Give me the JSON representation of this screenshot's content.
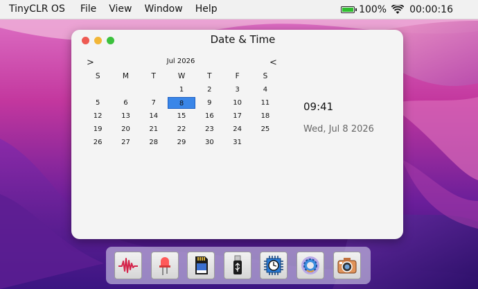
{
  "menubar": {
    "app_name": "TinyCLR OS",
    "menus": [
      "File",
      "View",
      "Window",
      "Help"
    ],
    "battery_percent": "100%",
    "battery_level": 1.0,
    "clock": "00:00:16"
  },
  "window": {
    "title": "Date & Time",
    "calendar": {
      "month_label": "Jul 2026",
      "next_glyph": ">",
      "prev_glyph": "<",
      "weekdays": [
        "S",
        "M",
        "T",
        "W",
        "T",
        "F",
        "S"
      ],
      "weeks": [
        [
          "",
          "",
          "",
          "1",
          "2",
          "3",
          "4"
        ],
        [
          "5",
          "6",
          "7",
          "8",
          "9",
          "10",
          "11"
        ],
        [
          "12",
          "13",
          "14",
          "15",
          "16",
          "17",
          "18"
        ],
        [
          "19",
          "20",
          "21",
          "22",
          "23",
          "24",
          "25"
        ],
        [
          "26",
          "27",
          "28",
          "29",
          "30",
          "31",
          ""
        ]
      ],
      "selected_day": "8"
    },
    "time": "09:41",
    "date": "Wed, Jul 8 2026"
  },
  "dock": {
    "icons": [
      "waveform-icon",
      "led-icon",
      "sd-card-icon",
      "usb-drive-icon",
      "chip-clock-icon",
      "settings-gear-icon",
      "camera-icon"
    ]
  },
  "colors": {
    "selected_day": "#3a86e8",
    "battery": "#2fbf2f"
  }
}
